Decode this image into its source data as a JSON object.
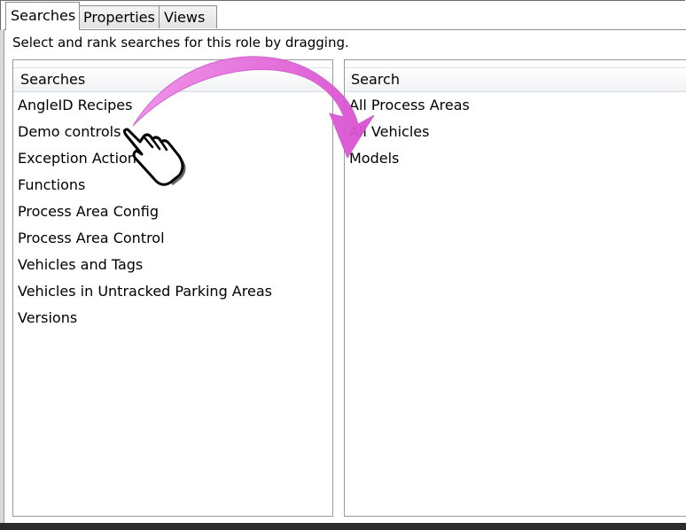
{
  "tabs": [
    {
      "label": "Searches",
      "active": true
    },
    {
      "label": "Properties",
      "active": false
    },
    {
      "label": "Views",
      "active": false
    }
  ],
  "instruction": "Select and rank searches for this role by dragging.",
  "left_panel": {
    "header": "Searches",
    "items": [
      "AngleID Recipes",
      "Demo controls",
      "Exception Actions",
      "Functions",
      "Process Area Config",
      "Process Area Control",
      "Vehicles and Tags",
      "Vehicles in Untracked Parking Areas",
      "Versions"
    ]
  },
  "right_panel": {
    "header": "Search",
    "items": [
      "All Process Areas",
      "All Vehicles",
      "Models"
    ]
  },
  "annotation": {
    "arrow_color": "#e05cd6",
    "arrow_meaning": "drag from left list to right list",
    "cursor_icon": "hand-pointer-icon"
  }
}
